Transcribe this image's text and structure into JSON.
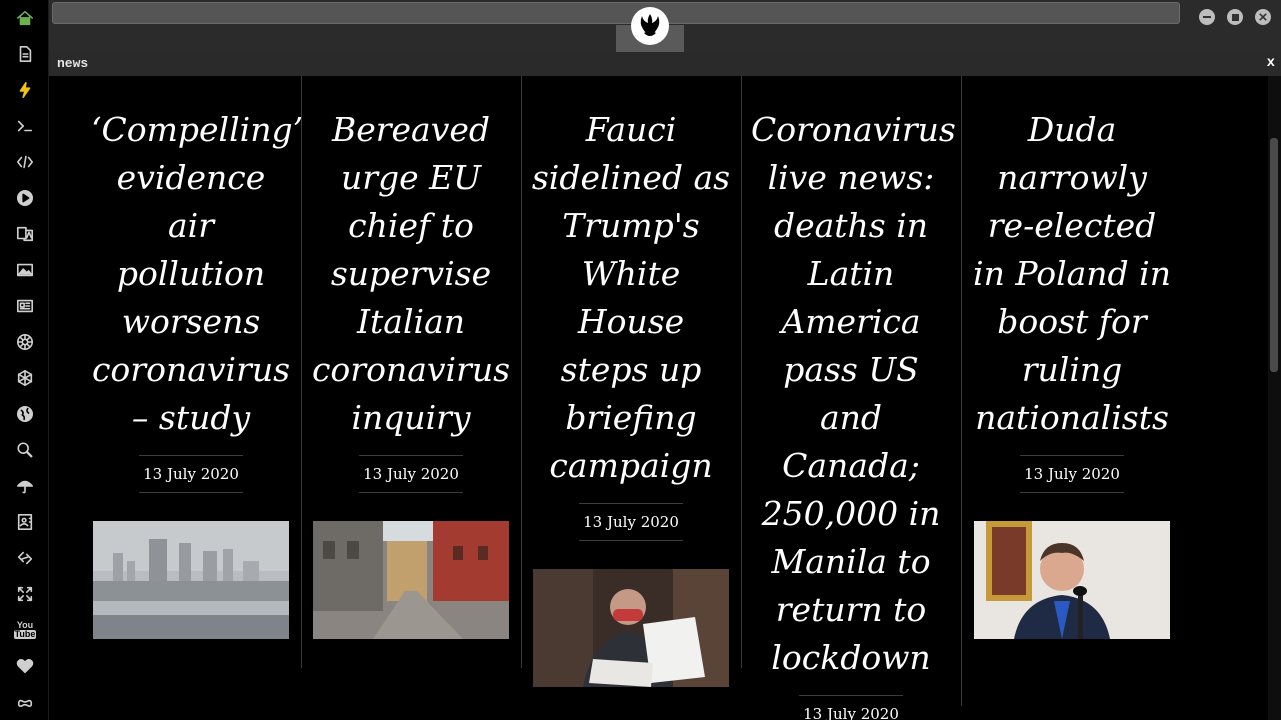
{
  "rail": {
    "items": [
      {
        "name": "home-icon"
      },
      {
        "name": "document-icon"
      },
      {
        "name": "bolt-icon"
      },
      {
        "name": "terminal-icon"
      },
      {
        "name": "code-icon"
      },
      {
        "name": "play-icon"
      },
      {
        "name": "translate-icon"
      },
      {
        "name": "image-icon"
      },
      {
        "name": "newspaper-icon"
      },
      {
        "name": "empire-icon"
      },
      {
        "name": "hexagon-network-icon"
      },
      {
        "name": "globe-icon"
      },
      {
        "name": "search-icon"
      },
      {
        "name": "umbrella-icon"
      },
      {
        "name": "contact-card-icon"
      },
      {
        "name": "link-icon"
      },
      {
        "name": "expand-arrows-icon"
      },
      {
        "name": "youtube-icon"
      },
      {
        "name": "heart-icon"
      },
      {
        "name": "infinity-cloud-icon"
      }
    ],
    "youtube_label_top": "You",
    "youtube_label_bottom": "Tube",
    "accent": "#6ab04c"
  },
  "panel": {
    "title": "news",
    "close": "x"
  },
  "articles": [
    {
      "headline": "‘Compelling’ evidence air pollution worsens coronavirus – study",
      "date": "13 July 2020",
      "image": "hazy-city-skyline"
    },
    {
      "headline": "Bereaved urge EU chief to supervise Italian coronavirus inquiry",
      "date": "13 July 2020",
      "image": "italian-street"
    },
    {
      "headline": "Fauci sidelined as Trump's White House steps up briefing campaign",
      "date": "13 July 2020",
      "image": "man-with-mask-reading"
    },
    {
      "headline": "Coronavirus live news: deaths in Latin America pass US and Canada; 250,000 in Manila to return to lockdown",
      "date": "13 July 2020",
      "image": ""
    },
    {
      "headline": "Duda narrowly re-elected in Poland in boost for ruling nationalists",
      "date": "13 July 2020",
      "image": "man-at-podium"
    }
  ]
}
